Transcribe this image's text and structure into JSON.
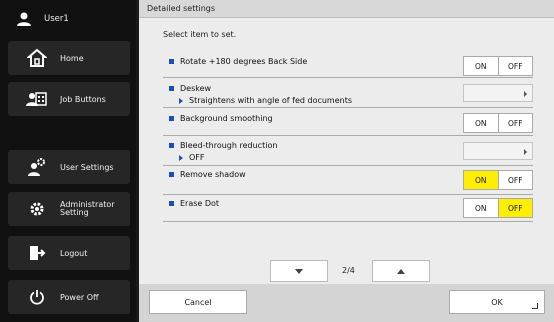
{
  "user": {
    "name": "User1"
  },
  "sidebar": {
    "items": [
      {
        "label": "Home",
        "icon": "home-icon"
      },
      {
        "label": "Job Buttons",
        "icon": "job-buttons-icon"
      },
      {
        "label": "User Settings",
        "icon": "user-settings-icon"
      },
      {
        "label_line1": "Administrator",
        "label_line2": "Setting",
        "icon": "gear-icon"
      },
      {
        "label": "Logout",
        "icon": "logout-icon"
      },
      {
        "label": "Power Off",
        "icon": "power-icon"
      }
    ]
  },
  "panel": {
    "title": "Detailed settings",
    "instruction": "Select item to set.",
    "settings": [
      {
        "label": "Rotate +180 degrees Back Side",
        "type": "toggle",
        "on_label": "ON",
        "off_label": "OFF",
        "value": "none"
      },
      {
        "label": "Deskew",
        "sub": "Straightens with angle of fed documents",
        "type": "select"
      },
      {
        "label": "Background smoothing",
        "type": "toggle",
        "on_label": "ON",
        "off_label": "OFF",
        "value": "none"
      },
      {
        "label": "Bleed-through reduction",
        "sub": "OFF",
        "type": "select"
      },
      {
        "label": "Remove shadow",
        "type": "toggle",
        "on_label": "ON",
        "off_label": "OFF",
        "value": "on"
      },
      {
        "label": "Erase Dot",
        "type": "toggle",
        "on_label": "ON",
        "off_label": "OFF",
        "value": "off"
      }
    ],
    "pager": {
      "text": "2/4"
    },
    "footer": {
      "cancel_label": "Cancel",
      "ok_label": "OK"
    }
  },
  "colors": {
    "selected": "#ffee00",
    "accent": "#1a4fb5",
    "sidebar_bg": "#111111"
  }
}
